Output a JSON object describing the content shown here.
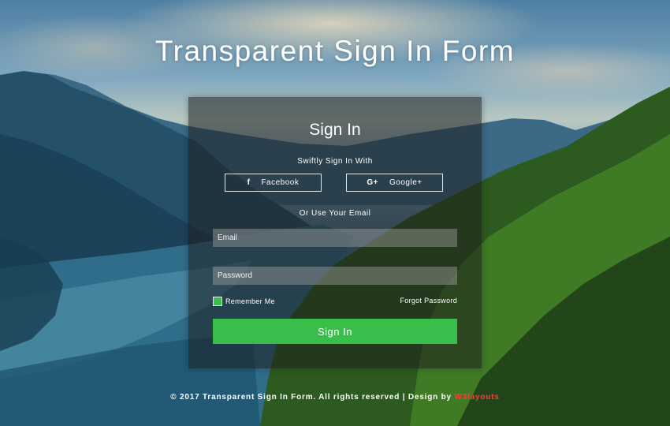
{
  "page": {
    "title": "Transparent Sign In Form"
  },
  "form": {
    "heading": "Sign In",
    "social_prompt": "Swiftly Sign In With",
    "facebook_label": "Facebook",
    "facebook_icon": "f",
    "google_label": "Google+",
    "google_icon": "G+",
    "email_prompt": "Or Use Your Email",
    "email_placeholder": "Email",
    "password_placeholder": "Password",
    "remember_label": "Remember Me",
    "remember_checked": true,
    "forgot_label": "Forgot Password",
    "submit_label": "Sign In"
  },
  "footer": {
    "text": "© 2017 Transparent Sign In Form. All rights reserved | Design by ",
    "brand": "W3layouts"
  },
  "colors": {
    "accent": "#39be4c",
    "brand_link": "#ff3b3b",
    "panel": "rgba(30,30,30,0.55)"
  }
}
